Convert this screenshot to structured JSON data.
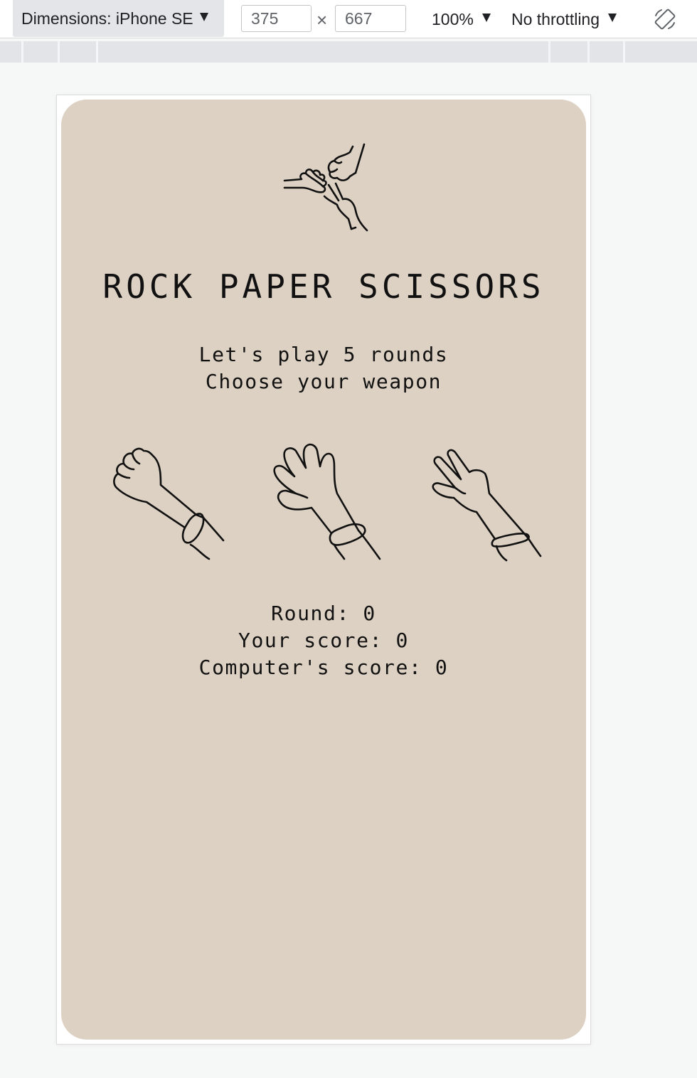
{
  "devtools": {
    "device_label": "Dimensions: iPhone SE",
    "width_value": "375",
    "height_value": "667",
    "times": "×",
    "zoom": "100%",
    "throttling": "No throttling",
    "rotate_icon": "rotate-device-icon"
  },
  "app": {
    "logo_icon": "rock-paper-scissors-hands-icon",
    "title": "ROCK PAPER SCISSORS",
    "intro_line1": "Let's play 5 rounds",
    "intro_line2": "Choose your weapon",
    "weapons": [
      {
        "name": "rock",
        "icon": "rock-fist-icon"
      },
      {
        "name": "paper",
        "icon": "paper-hand-icon"
      },
      {
        "name": "scissors",
        "icon": "scissors-hand-icon"
      }
    ],
    "round_text": "Round: 0",
    "player_score_text": "Your score: 0",
    "computer_score_text": "Computer's score: 0"
  },
  "colors": {
    "app_background": "#ddd1c3",
    "ink": "#111111",
    "page_background": "#f6f7f7",
    "toolbar_select": "#e4e5e8"
  }
}
